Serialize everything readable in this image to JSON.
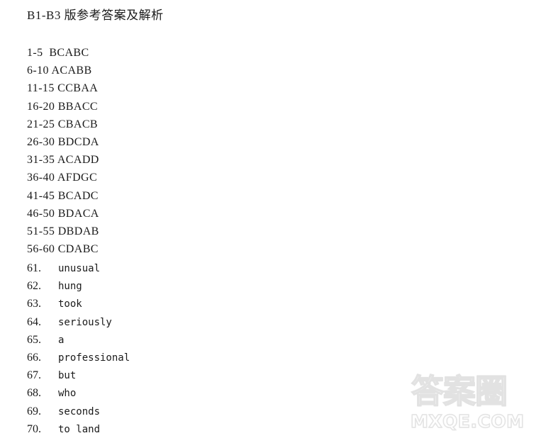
{
  "document": {
    "title": "B1-B3 版参考答案及解析",
    "background_color": "#ffffff",
    "text_color": "#1a1a1a"
  },
  "multiple_choice_answers": [
    {
      "range": "1-5",
      "answers": "BCABC",
      "line": "1-5  BCABC"
    },
    {
      "range": "6-10",
      "answers": "ACABB",
      "line": "6-10 ACABB"
    },
    {
      "range": "11-15",
      "answers": "CCBAA",
      "line": "11-15 CCBAA"
    },
    {
      "range": "16-20",
      "answers": "BBACC",
      "line": "16-20 BBACC"
    },
    {
      "range": "21-25",
      "answers": "CBACB",
      "line": "21-25 CBACB"
    },
    {
      "range": "26-30",
      "answers": "BDCDA",
      "line": "26-30 BDCDA"
    },
    {
      "range": "31-35",
      "answers": "ACADD",
      "line": "31-35 ACADD"
    },
    {
      "range": "36-40",
      "answers": "AFDGC",
      "line": "36-40 AFDGC"
    },
    {
      "range": "41-45",
      "answers": "BCADC",
      "line": "41-45 BCADC"
    },
    {
      "range": "46-50",
      "answers": "BDACA",
      "line": "46-50 BDACA"
    },
    {
      "range": "51-55",
      "answers": "DBDAB",
      "line": "51-55 DBDAB"
    },
    {
      "range": "56-60",
      "answers": "CDABC",
      "line": "56-60 CDABC"
    }
  ],
  "fill_in_blank_answers": [
    {
      "number": "61.",
      "word": "unusual"
    },
    {
      "number": "62.",
      "word": "hung"
    },
    {
      "number": "63.",
      "word": "took"
    },
    {
      "number": "64.",
      "word": "seriously"
    },
    {
      "number": "65.",
      "word": "a"
    },
    {
      "number": "66.",
      "word": "professional"
    },
    {
      "number": "67.",
      "word": "but"
    },
    {
      "number": "68.",
      "word": "who"
    },
    {
      "number": "69.",
      "word": "seconds"
    },
    {
      "number": "70.",
      "word": "to land"
    }
  ],
  "watermark": {
    "chinese": "答案圈",
    "site": "MXQE.COM",
    "color": "#eeeeee"
  }
}
